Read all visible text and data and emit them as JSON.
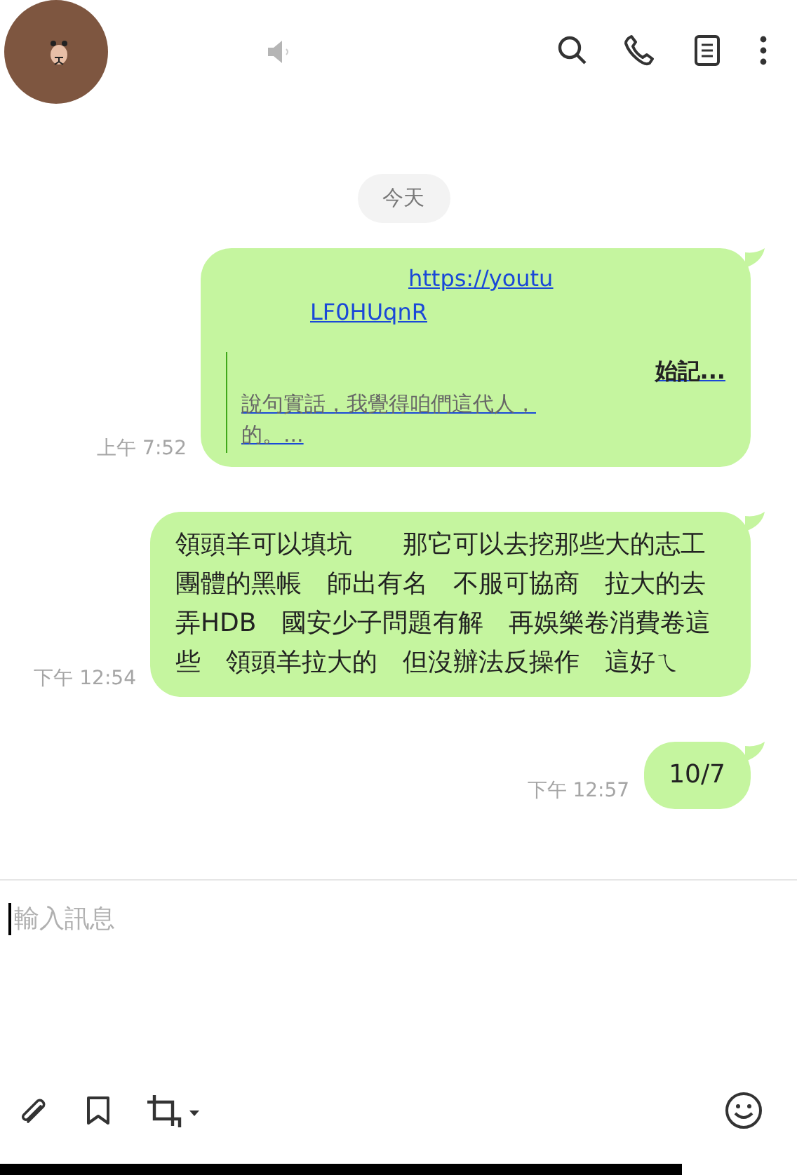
{
  "header": {
    "muted": true
  },
  "date_label": "今天",
  "messages": [
    {
      "kind": "link",
      "time": "上午 7:52",
      "link_lines": [
        "https://youtu",
        "LF0HUqnR"
      ],
      "preview_title": "始記...",
      "preview_lines": [
        "說句實話，我覺得咱們這代人，",
        "的。..."
      ]
    },
    {
      "kind": "text",
      "time": "下午 12:54",
      "text": "領頭羊可以填坑　　那它可以去挖那些大的志工團體的黑帳　師出有名　不服可協商　拉大的去弄HDB　國安少子問題有解　再娛樂卷消費卷這些　領頭羊拉大的　但沒辦法反操作　這好ㄟ"
    },
    {
      "kind": "text",
      "time": "下午 12:57",
      "text": "10/7"
    }
  ],
  "composer": {
    "placeholder": "輸入訊息"
  }
}
